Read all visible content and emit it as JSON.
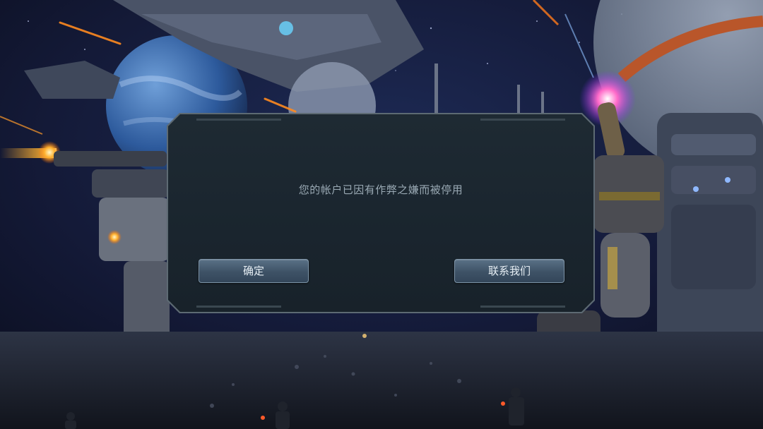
{
  "colors": {
    "message_text": "#9aa9b4",
    "button_text": "#e6eef4",
    "panel_background": "#1c2730",
    "panel_border": "#5d6a73",
    "muzzle_fire": "#ffb02e",
    "plasma_glow": "#ff4fd8"
  },
  "dialog": {
    "message": "您的帐户已因有作弊之嫌而被停用",
    "confirm_label": "确定",
    "contact_label": "联系我们"
  },
  "icons": {
    "planet": "planet-icon",
    "mech": "mech-icon",
    "spaceship": "spaceship-icon",
    "soldier": "soldier-icon"
  }
}
